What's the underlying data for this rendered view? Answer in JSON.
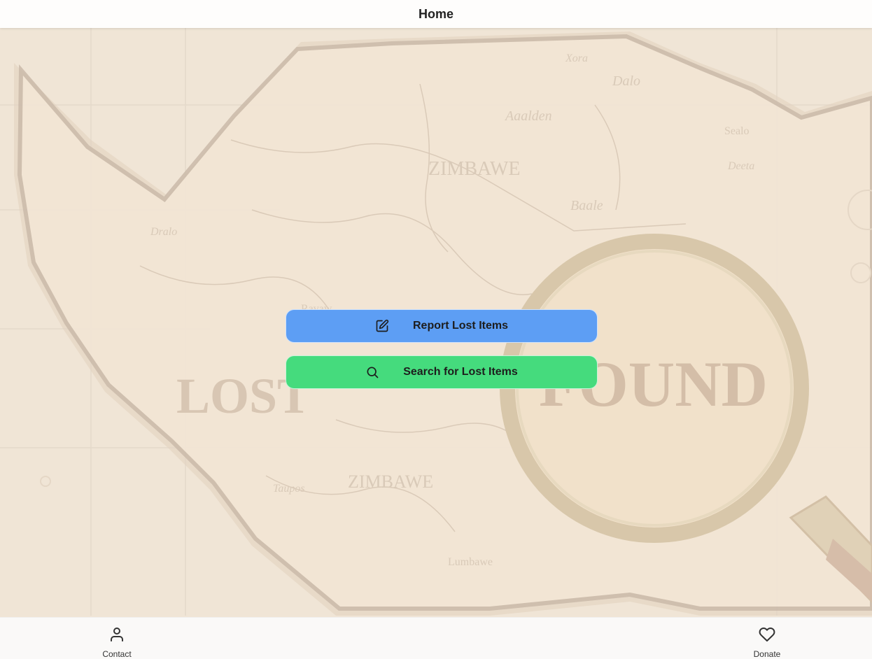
{
  "header": {
    "title": "Home"
  },
  "actions": {
    "report": {
      "label": "Report Lost Items",
      "icon": "edit-icon",
      "color": "#5d9ef4"
    },
    "search": {
      "label": "Search for Lost Items",
      "icon": "search-icon",
      "color": "#45db7d"
    }
  },
  "background": {
    "map_labels": [
      "Xora",
      "Zimbawe",
      "Aaalden",
      "Dalo",
      "Sealo",
      "Baale",
      "Dralo",
      "Deeta",
      "Ravaw",
      "Zimbawe",
      "Taupos",
      "Lumbawe"
    ],
    "lost_text": "LOST",
    "found_text": "FOUND"
  },
  "footer": {
    "contact": {
      "label": "Contact",
      "icon": "user-icon"
    },
    "donate": {
      "label": "Donate",
      "icon": "heart-icon"
    }
  }
}
